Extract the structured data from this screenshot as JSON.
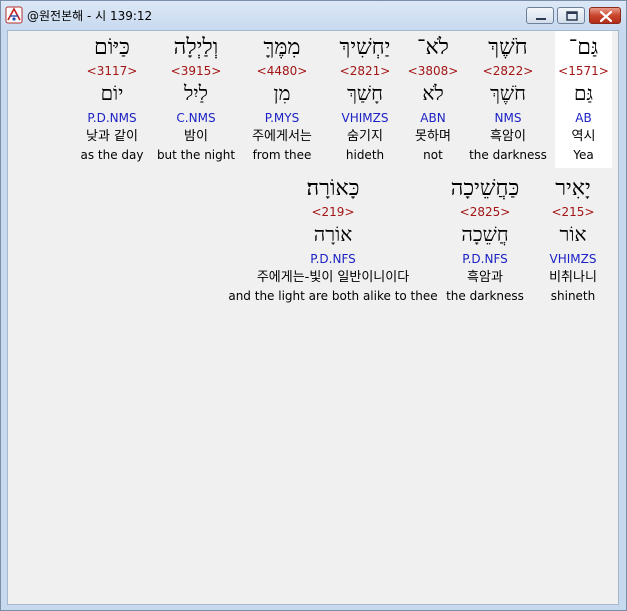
{
  "window": {
    "title": "@원전본해 - 시 139:12",
    "icon": "app-logo-icon",
    "controls": [
      "minimize-icon",
      "maximize-icon",
      "close-icon"
    ]
  },
  "verse": {
    "line1": [
      {
        "hebrew": "גַּם־",
        "strongs": "<1571>",
        "lexeme": "גַּם",
        "morph": "AB",
        "korean": "역시",
        "english": "Yea",
        "selected": true
      },
      {
        "hebrew": "חֹשֶׁךְ",
        "strongs": "<2822>",
        "lexeme": "חֹשֶׁךְ",
        "morph": "NMS",
        "korean": "흑암이",
        "english": "the darkness",
        "selected": false
      },
      {
        "hebrew": "לֹא־",
        "strongs": "<3808>",
        "lexeme": "לֹא",
        "morph": "ABN",
        "korean": "못하며",
        "english": "not",
        "selected": false
      },
      {
        "hebrew": "יַחְשִׁיךְ",
        "strongs": "<2821>",
        "lexeme": "חָשַׁךְ",
        "morph": "VHIMZS",
        "korean": "숨기지",
        "english": "hideth",
        "selected": false
      },
      {
        "hebrew": "מִמֶּךָּ",
        "strongs": "<4480>",
        "lexeme": "מִן",
        "morph": "P.MYS",
        "korean": "주에게서는",
        "english": "from thee",
        "selected": false
      },
      {
        "hebrew": "וְלַיְלָה",
        "strongs": "<3915>",
        "lexeme": "לַיִל",
        "morph": "C.NMS",
        "korean": "밤이",
        "english": "but the night",
        "selected": false
      },
      {
        "hebrew": "כַּיּוֹם",
        "strongs": "<3117>",
        "lexeme": "יוֹם",
        "morph": "P.D.NMS",
        "korean": "낮과 같이",
        "english": "as the day",
        "selected": false
      }
    ],
    "line2": [
      {
        "hebrew": "יָאִיר",
        "strongs": "<215>",
        "lexeme": "אוֹר",
        "morph": "VHIMZS",
        "korean": "비취나니",
        "english": "shineth",
        "selected": false
      },
      {
        "hebrew": "כַּחֲשֵׁיכָה",
        "strongs": "<2825>",
        "lexeme": "חֲשֵׁכָה",
        "morph": "P.D.NFS",
        "korean": "흑암과",
        "english": "the darkness",
        "selected": false
      },
      {
        "hebrew": "כָּאוֹרָה׃",
        "strongs": "<219>",
        "lexeme": "אוֹרָה",
        "morph": "P.D.NFS",
        "korean": "주에게는-빛이 일반이니이다",
        "english": "and the light are both alike to thee",
        "selected": false
      }
    ]
  }
}
